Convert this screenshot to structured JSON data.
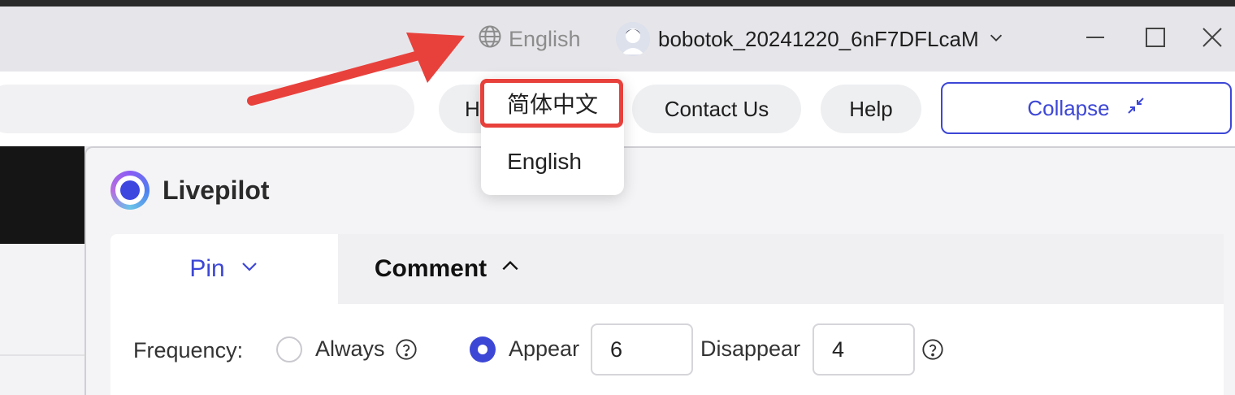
{
  "titlebar": {
    "language_current": "English",
    "username": "bobotok_20241220_6nF7DFLcaM"
  },
  "toolbar": {
    "home_label": "H",
    "contact_label": "Contact Us",
    "help_label": "Help",
    "collapse_label": "Collapse"
  },
  "language_dropdown": {
    "options": [
      "简体中文",
      "English"
    ]
  },
  "panel": {
    "brand_name": "Livepilot",
    "tabs": [
      {
        "label": "Pin",
        "active": true
      },
      {
        "label": "Comment",
        "active": false
      }
    ],
    "frequency": {
      "label": "Frequency:",
      "option_always": "Always",
      "option_appear": "Appear",
      "appear_value": "6",
      "disappear_label": "Disappear",
      "disappear_value": "4",
      "selected": "Appear"
    }
  },
  "colors": {
    "accent": "#3d47d6",
    "annotation": "#e8413c"
  }
}
